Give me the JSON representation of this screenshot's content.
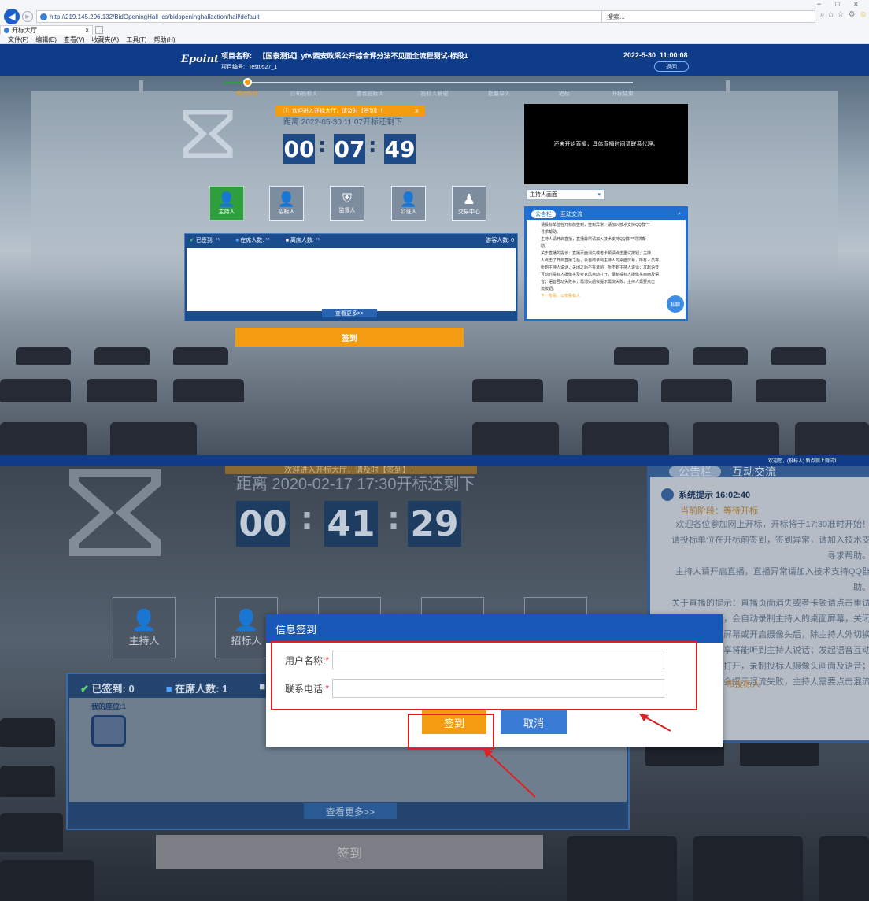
{
  "browser": {
    "url": "http://219.145.206.132/BidOpeningHall_cs/bidopeninghallaction/hall/default",
    "refresh_label": "▾ ↻",
    "search_placeholder": "搜索...",
    "tab_title": "开标大厅",
    "tab_close": "×",
    "menu": [
      "文件(F)",
      "编辑(E)",
      "查看(V)",
      "收藏夹(A)",
      "工具(T)",
      "帮助(H)"
    ],
    "window_controls": [
      "−",
      "□",
      "×"
    ]
  },
  "header": {
    "logo": "Epoint",
    "project_name_label": "项目名称:",
    "project_name": "【国泰测试】yfw西安政采公开综合评分法不见面全流程测试-标段1",
    "project_code_label": "项目编号:",
    "project_code": "Test0527_1",
    "datetime": "2022-5-30  11:00:08",
    "return_label": "返回"
  },
  "steps": [
    "等待开标",
    "公布投标人",
    "查看投标人",
    "投标人解密",
    "批量导入",
    "唱标",
    "开标结束"
  ],
  "notice_bar": {
    "text": "欢迎进入开标大厅，请及时【签到】！",
    "close": "×"
  },
  "countdown_top": {
    "caption": "距离 2022-05-30 11:07开标还剩下",
    "hours": "00",
    "minutes": "07",
    "seconds": "49"
  },
  "roles": [
    {
      "label": "主持人",
      "active": true
    },
    {
      "label": "招标人",
      "active": false
    },
    {
      "label": "监督人",
      "active": false
    },
    {
      "label": "公证人",
      "active": false
    },
    {
      "label": "交易中心",
      "active": false
    }
  ],
  "attendance_top": {
    "signed": "已签到: **",
    "online": "在席人数: **",
    "offline": "离席人数: **",
    "visitors": "游客人数: 0",
    "more_label": "查看更多>>"
  },
  "sign_button_label": "签到",
  "live": {
    "message": "还未开始直播，具体直播时间请联系代理。",
    "select_value": "主持人画面"
  },
  "notice_panel": {
    "tab_notice": "公告栏",
    "tab_chat": "互动交流",
    "lines": [
      "请投标单位在开标前签到，签到异常，请加入技术支持QQ群***",
      "寻求帮助。",
      "主持人请开启直播，直播异常请加入技术支持QQ群***寻求帮",
      "助。",
      "关于直播的提示：直播页面消失或者卡顿请点击重试按钮；主持",
      "人点击了开启直播之后，会自动录制主持人的桌面屏幕，所有人员将",
      "听到主持人说话，关闭之后不在录制，听不到主持人说话；发起语音",
      "互动时投标人摄像头及麦克风自动打开，录制投标人摄像头画面及语",
      "音；语音互动失败将，需消失后会提示需流失败，主持人需要点击",
      "流按钮。"
    ],
    "link": "下一阶段：公布投标人",
    "private_label": "私聊"
  },
  "footer_welcome": "欢迎您，(投标人) 新点测上测试1",
  "bottom": {
    "faded_notice": "欢迎进入开标大厅，请及时【签到】！",
    "countdown_caption": "距离 2020-02-17 17:30开标还剩下",
    "hours": "00",
    "minutes": "41",
    "seconds": "29",
    "roles": [
      "主持人",
      "招标人"
    ],
    "signed": "已签到: 0",
    "online": "在席人数: 1",
    "seat_label": "我的座位:1",
    "more_label": "查看更多>>",
    "sign_button_label": "签到",
    "tab_notice": "公告栏",
    "tab_chat": "互动交流",
    "system_title": "系统提示 16:02:40",
    "stage_line": "当前阶段：等待开标",
    "notice_lines": [
      "欢迎各位参加网上开标，开标将于17:30准时开始！",
      "请投标单位在开标前签到，签到异常，请加入技术支",
      "寻求帮助。",
      "主持人请开启直播，直播异常请加入技术支持QQ群",
      "助。",
      "关于直播的提示：直播页面消失或者卡顿请点击重试",
      "人开启直播之后，会自动录制主持人的桌面屏幕，关闭",
      "分享屏幕或开启摄像头后，除主持人外切换",
      "面分享将能听到主持人说话；发起语音互动",
      "自动打开，录制投标人摄像头画面及语音；",
      "数会提示混流失败，主持人需要点击混流"
    ],
    "notice_link": "布投标人"
  },
  "dialog": {
    "title": "信息签到",
    "username_label": "用户名称:",
    "phone_label": "联系电话:",
    "required_mark": "*",
    "username_value": "",
    "phone_value": "",
    "confirm_label": "签到",
    "cancel_label": "取消"
  },
  "colors": {
    "header_blue": "#0e3c88",
    "orange": "#f39c12",
    "green": "#2e9e3e",
    "annotation_red": "#e02020",
    "dialog_blue": "#1a58b8"
  }
}
